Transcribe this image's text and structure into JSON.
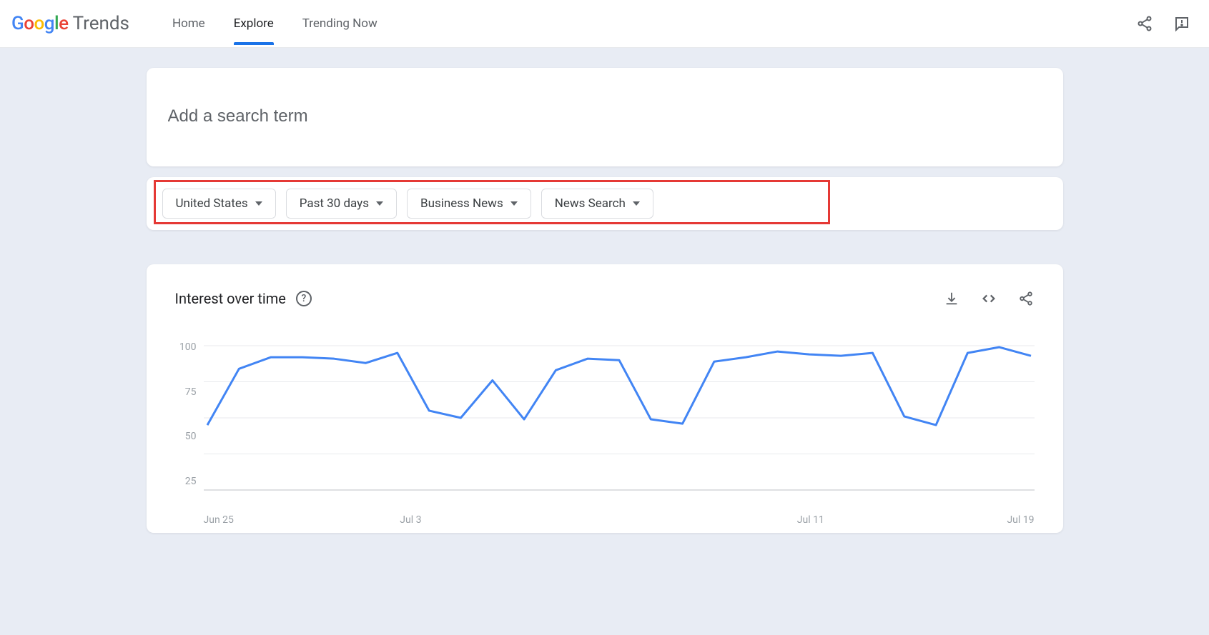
{
  "header": {
    "logo_brand": "Google",
    "logo_product": "Trends",
    "nav": [
      {
        "label": "Home",
        "active": false
      },
      {
        "label": "Explore",
        "active": true
      },
      {
        "label": "Trending Now",
        "active": false
      }
    ]
  },
  "search": {
    "placeholder": "Add a search term"
  },
  "filters": [
    {
      "label": "United States"
    },
    {
      "label": "Past 30 days"
    },
    {
      "label": "Business News"
    },
    {
      "label": "News Search"
    }
  ],
  "chart": {
    "title": "Interest over time"
  },
  "chart_data": {
    "type": "line",
    "title": "Interest over time",
    "ylabel": "",
    "xlabel": "",
    "ylim": [
      0,
      100
    ],
    "y_ticks": [
      100,
      75,
      50,
      25
    ],
    "x_ticks": [
      "Jun 25",
      "Jul 3",
      "Jul 11",
      "Jul 19"
    ],
    "x": [
      0,
      1,
      2,
      3,
      4,
      5,
      6,
      7,
      8,
      9,
      10,
      11,
      12,
      13,
      14,
      15,
      16,
      17,
      18,
      19,
      20,
      21,
      22,
      23,
      24,
      25,
      26
    ],
    "values": [
      45,
      84,
      92,
      92,
      91,
      88,
      95,
      55,
      50,
      76,
      49,
      83,
      91,
      90,
      49,
      46,
      89,
      92,
      96,
      94,
      93,
      95,
      51,
      45,
      95,
      99,
      93
    ],
    "color": "#4285f4"
  }
}
